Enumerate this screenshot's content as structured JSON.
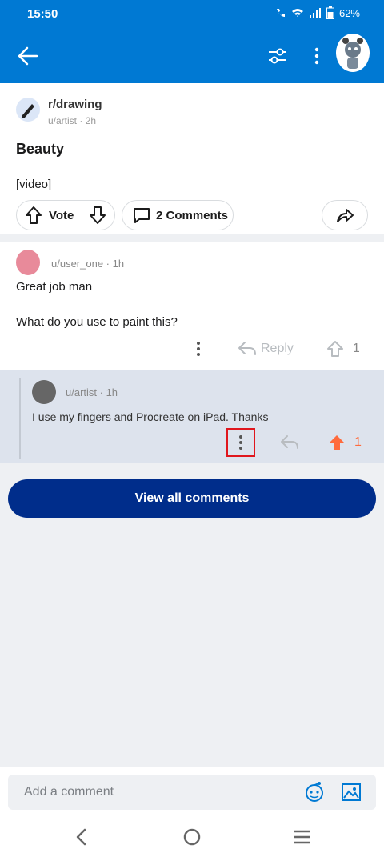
{
  "status_bar": {
    "time": "15:50",
    "battery": "62%"
  },
  "app_bar": {
    "back_icon": "arrow-left-icon",
    "filter_icon": "sliders-icon",
    "more_icon": "more-vertical-icon",
    "avatar": "snoo-avatar"
  },
  "post": {
    "subreddit": "r/drawing",
    "meta": "u/artist · 2h",
    "title": "Beauty",
    "body": "[video]",
    "vote_label": "Vote",
    "comments_label": "2 Comments"
  },
  "comments": [
    {
      "username": "u/user_one · 1h",
      "text1": "Great job man",
      "text2": "What do you use to paint this?",
      "reply_label": "Reply",
      "score": "1"
    },
    {
      "username": "u/artist · 1h",
      "text": "I use my fingers and Procreate on iPad. Thanks",
      "score": "1"
    }
  ],
  "view_all_label": "View all comments",
  "composer": {
    "placeholder": "Add a comment"
  },
  "colors": {
    "brand": "#0079d3",
    "upvote": "#ff6b3d",
    "button": "#002d8b"
  }
}
